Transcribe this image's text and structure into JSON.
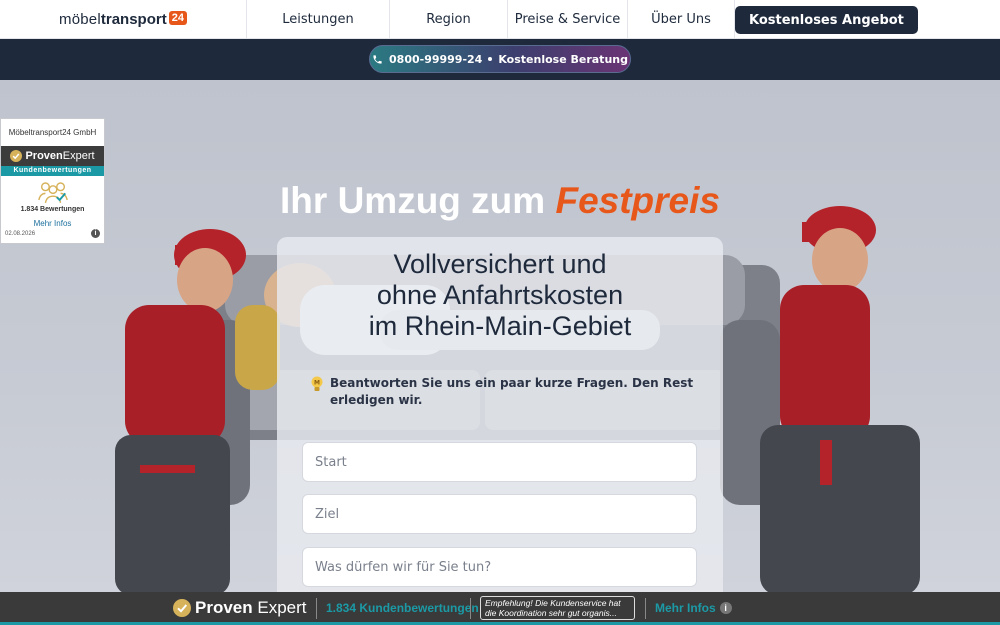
{
  "nav": {
    "logo": {
      "pre": "möbel",
      "bold": "transport",
      "badge": "24"
    },
    "items": [
      {
        "label": "Leistungen"
      },
      {
        "label": "Region"
      },
      {
        "label": "Preise & Service"
      },
      {
        "label": "Über Uns"
      }
    ],
    "cta_label": "Kostenloses Angebot"
  },
  "subbar": {
    "phone": "0800-99999-24",
    "consult": "Kostenlose Beratung"
  },
  "hero": {
    "title_plain": "Ihr Umzug zum ",
    "title_accent": "Festpreis"
  },
  "form": {
    "heading_lines": [
      "Vollversichert und",
      "ohne Anfahrtskosten",
      "im Rhein-Main-Gebiet"
    ],
    "hint": "Beantworten Sie uns ein paar kurze Fragen. Den Rest erledigen wir.",
    "fields": [
      {
        "placeholder": "Start"
      },
      {
        "placeholder": "Ziel"
      },
      {
        "placeholder": "Was dürfen wir für Sie tun?"
      }
    ]
  },
  "proven_expert_widget": {
    "company": "Möbeltransport24 GmbH",
    "brand_bold": "Proven",
    "brand_light": "Expert",
    "kunden": "Kundenbewertungen",
    "count": "1.834 Bewertungen",
    "more": "Mehr Infos",
    "date": "02.08.2026"
  },
  "proven_expert_bar": {
    "brand_bold": "Proven",
    "brand_light": "Expert",
    "count": "1.834 Kundenbewertungen",
    "quote_line1": "Empfehlung! Die Kundenservice hat",
    "quote_line2": "die Koordination sehr gut organis...",
    "more": "Mehr Infos"
  },
  "colors": {
    "navy": "#1e2a3c",
    "accent": "#e8571a",
    "teal": "#1b9aa6"
  }
}
